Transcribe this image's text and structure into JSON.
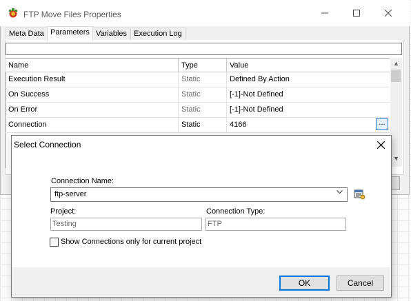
{
  "window": {
    "title": "FTP Move Files Properties"
  },
  "tabs": [
    {
      "label": "Meta Data"
    },
    {
      "label": "Parameters"
    },
    {
      "label": "Variables"
    },
    {
      "label": "Execution Log"
    }
  ],
  "grid": {
    "columns": [
      "Name",
      "Type",
      "Value"
    ],
    "rows": [
      {
        "name": "Execution Result",
        "type": "Static",
        "value": "Defined By Action"
      },
      {
        "name": "On Success",
        "type": "Static",
        "value": "[-1]-Not Defined"
      },
      {
        "name": "On Error",
        "type": "Static",
        "value": "[-1]-Not Defined"
      },
      {
        "name": "Connection",
        "type": "Static",
        "value": "4166"
      }
    ],
    "ellipsis_label": "..."
  },
  "dialog": {
    "title": "Select Connection",
    "connection_name_label": "Connection Name:",
    "connection_name_value": "ftp-server",
    "project_label": "Project:",
    "project_value": "Testing",
    "connection_type_label": "Connection Type:",
    "connection_type_value": "FTP",
    "show_current_label": "Show Connections only for current project",
    "show_current_checked": false,
    "ok_label": "OK",
    "cancel_label": "Cancel"
  },
  "icons": {
    "app": "app-icon",
    "minimize": "minimize-icon",
    "maximize": "maximize-icon",
    "close": "close-icon",
    "dropdown": "chevron-down-icon",
    "connection_settings": "connection-settings-icon"
  },
  "colors": {
    "focus_blue": "#0078d7",
    "window_bg": "#f0f0f0"
  }
}
